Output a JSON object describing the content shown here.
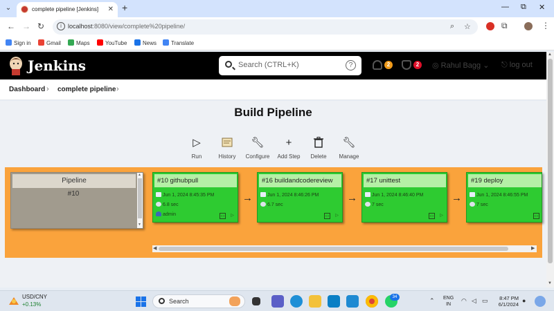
{
  "browser": {
    "tab_title": "complete pipeline [Jenkins]",
    "url_host": "localhost",
    "url_path": ":8080/view/complete%20pipeline/",
    "bookmarks": [
      {
        "label": "Sign in",
        "color": "#4285f4"
      },
      {
        "label": "Gmail",
        "color": "#ea4335"
      },
      {
        "label": "Maps",
        "color": "#34a853"
      },
      {
        "label": "YouTube",
        "color": "#ff0000"
      },
      {
        "label": "News",
        "color": "#1a73e8"
      },
      {
        "label": "Translate",
        "color": "#4285f4"
      }
    ]
  },
  "header": {
    "brand": "Jenkins",
    "search_placeholder": "Search (CTRL+K)",
    "notification_count": "2",
    "security_count": "2",
    "user_name": "Rahul Bagg",
    "logout_label": "log out"
  },
  "breadcrumb": {
    "items": [
      "Dashboard",
      "complete pipeline"
    ]
  },
  "main": {
    "title": "Build Pipeline",
    "actions": [
      {
        "label": "Run",
        "icon": "play-icon"
      },
      {
        "label": "History",
        "icon": "history-icon"
      },
      {
        "label": "Configure",
        "icon": "wrench-icon"
      },
      {
        "label": "Add Step",
        "icon": "plus-icon"
      },
      {
        "label": "Delete",
        "icon": "trash-icon"
      },
      {
        "label": "Manage",
        "icon": "wrench-icon"
      }
    ],
    "pipeline": {
      "header": "Pipeline",
      "number": "#10"
    },
    "stages": [
      {
        "title": "#10 githubpull",
        "date": "Jun 1, 2024 8:45:35 PM",
        "duration": "6.8 sec",
        "user": "admin"
      },
      {
        "title": "#16 buildandcodereview",
        "date": "Jun 1, 2024 8:46:26 PM",
        "duration": "6.7 sec",
        "user": ""
      },
      {
        "title": "#17 unittest",
        "date": "Jun 1, 2024 8:46:40 PM",
        "duration": "7 sec",
        "user": ""
      },
      {
        "title": "#19 deploy",
        "date": "Jun 1, 2024 8:46:55 PM",
        "duration": "7 sec",
        "user": ""
      }
    ],
    "colors": {
      "stage_success": "#2ecb31",
      "pipeline_bg": "#faa33c"
    }
  },
  "taskbar": {
    "ticker_symbol": "USD/CNY",
    "ticker_change": "+0.13%",
    "search_label": "Search",
    "chrome_badge": "34",
    "lang_line1": "ENG",
    "lang_line2": "IN",
    "time": "8:47 PM",
    "date": "6/1/2024"
  }
}
